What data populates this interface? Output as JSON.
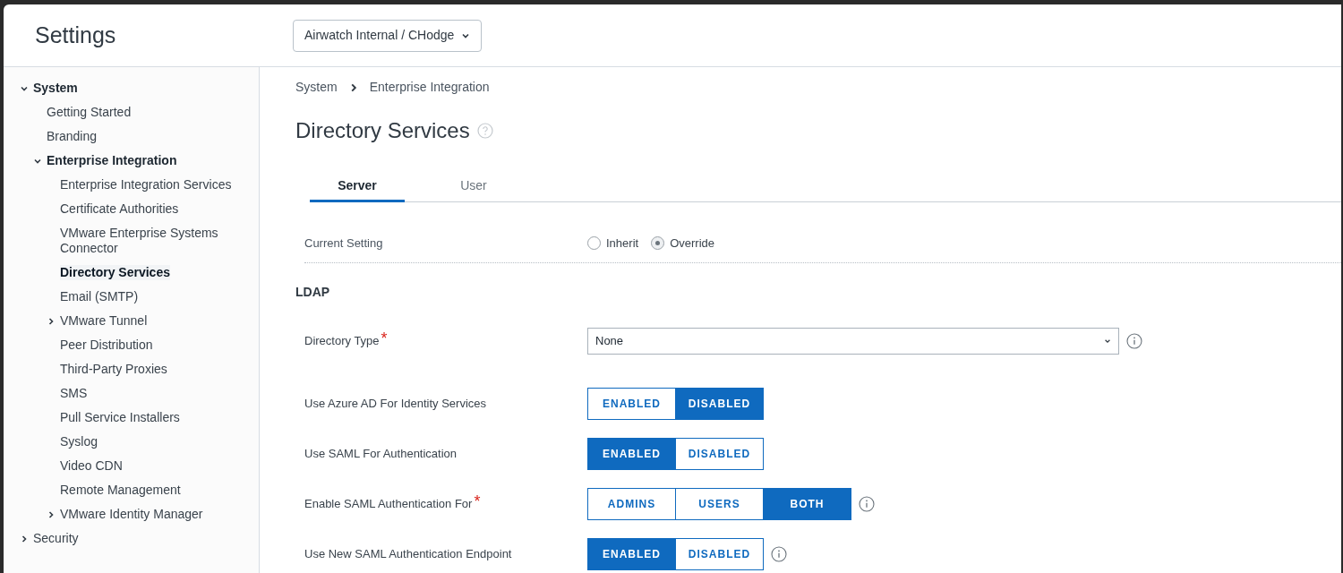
{
  "header": {
    "title": "Settings",
    "org_selector": "Airwatch Internal / CHodge"
  },
  "sidebar": {
    "items": [
      {
        "label": "System",
        "kind": "group",
        "expanded": true,
        "selected": false,
        "children": [
          {
            "label": "Getting Started",
            "kind": "leaf",
            "selected": false
          },
          {
            "label": "Branding",
            "kind": "leaf",
            "selected": false
          },
          {
            "label": "Enterprise Integration",
            "kind": "group",
            "expanded": true,
            "selected": false,
            "children": [
              {
                "label": "Enterprise Integration Services",
                "kind": "leaf",
                "selected": false
              },
              {
                "label": "Certificate Authorities",
                "kind": "leaf",
                "selected": false
              },
              {
                "label": "VMware Enterprise Systems Connector",
                "kind": "leaf",
                "selected": false
              },
              {
                "label": "Directory Services",
                "kind": "leaf",
                "selected": true
              },
              {
                "label": "Email (SMTP)",
                "kind": "leaf",
                "selected": false
              },
              {
                "label": "VMware Tunnel",
                "kind": "group",
                "expanded": false,
                "selected": false
              },
              {
                "label": "Peer Distribution",
                "kind": "leaf",
                "selected": false
              },
              {
                "label": "Third-Party Proxies",
                "kind": "leaf",
                "selected": false
              },
              {
                "label": "SMS",
                "kind": "leaf",
                "selected": false
              },
              {
                "label": "Pull Service Installers",
                "kind": "leaf",
                "selected": false
              },
              {
                "label": "Syslog",
                "kind": "leaf",
                "selected": false
              },
              {
                "label": "Video CDN",
                "kind": "leaf",
                "selected": false
              },
              {
                "label": "Remote Management",
                "kind": "leaf",
                "selected": false
              },
              {
                "label": "VMware Identity Manager",
                "kind": "group",
                "expanded": false,
                "selected": false
              }
            ]
          }
        ]
      },
      {
        "label": "Security",
        "kind": "group",
        "expanded": false,
        "selected": false
      }
    ]
  },
  "breadcrumb": [
    "System",
    "Enterprise Integration"
  ],
  "page_title": "Directory Services",
  "tabs": [
    {
      "label": "Server",
      "selected": true
    },
    {
      "label": "User",
      "selected": false
    }
  ],
  "current_setting": {
    "label": "Current Setting",
    "options": [
      {
        "label": "Inherit",
        "selected": false
      },
      {
        "label": "Override",
        "selected": true
      }
    ]
  },
  "section_title": "LDAP",
  "fields": [
    {
      "kind": "select",
      "label": "Directory Type",
      "required_mark": "*",
      "info": true,
      "value": "None"
    },
    {
      "kind": "segmented",
      "label": "Use Azure AD For Identity Services",
      "info": false,
      "options": [
        {
          "label": "ENABLED",
          "selected": false
        },
        {
          "label": "DISABLED",
          "selected": true
        }
      ]
    },
    {
      "kind": "segmented",
      "label": "Use SAML For Authentication",
      "info": false,
      "options": [
        {
          "label": "ENABLED",
          "selected": true
        },
        {
          "label": "DISABLED",
          "selected": false
        }
      ]
    },
    {
      "kind": "segmented",
      "label": "Enable SAML Authentication For",
      "required_mark": "*",
      "info": true,
      "options": [
        {
          "label": "ADMINS",
          "selected": false
        },
        {
          "label": "USERS",
          "selected": false
        },
        {
          "label": "BOTH",
          "selected": true
        }
      ]
    },
    {
      "kind": "segmented",
      "label": "Use New SAML Authentication Endpoint",
      "info": true,
      "options": [
        {
          "label": "ENABLED",
          "selected": true
        },
        {
          "label": "DISABLED",
          "selected": false
        }
      ]
    }
  ]
}
